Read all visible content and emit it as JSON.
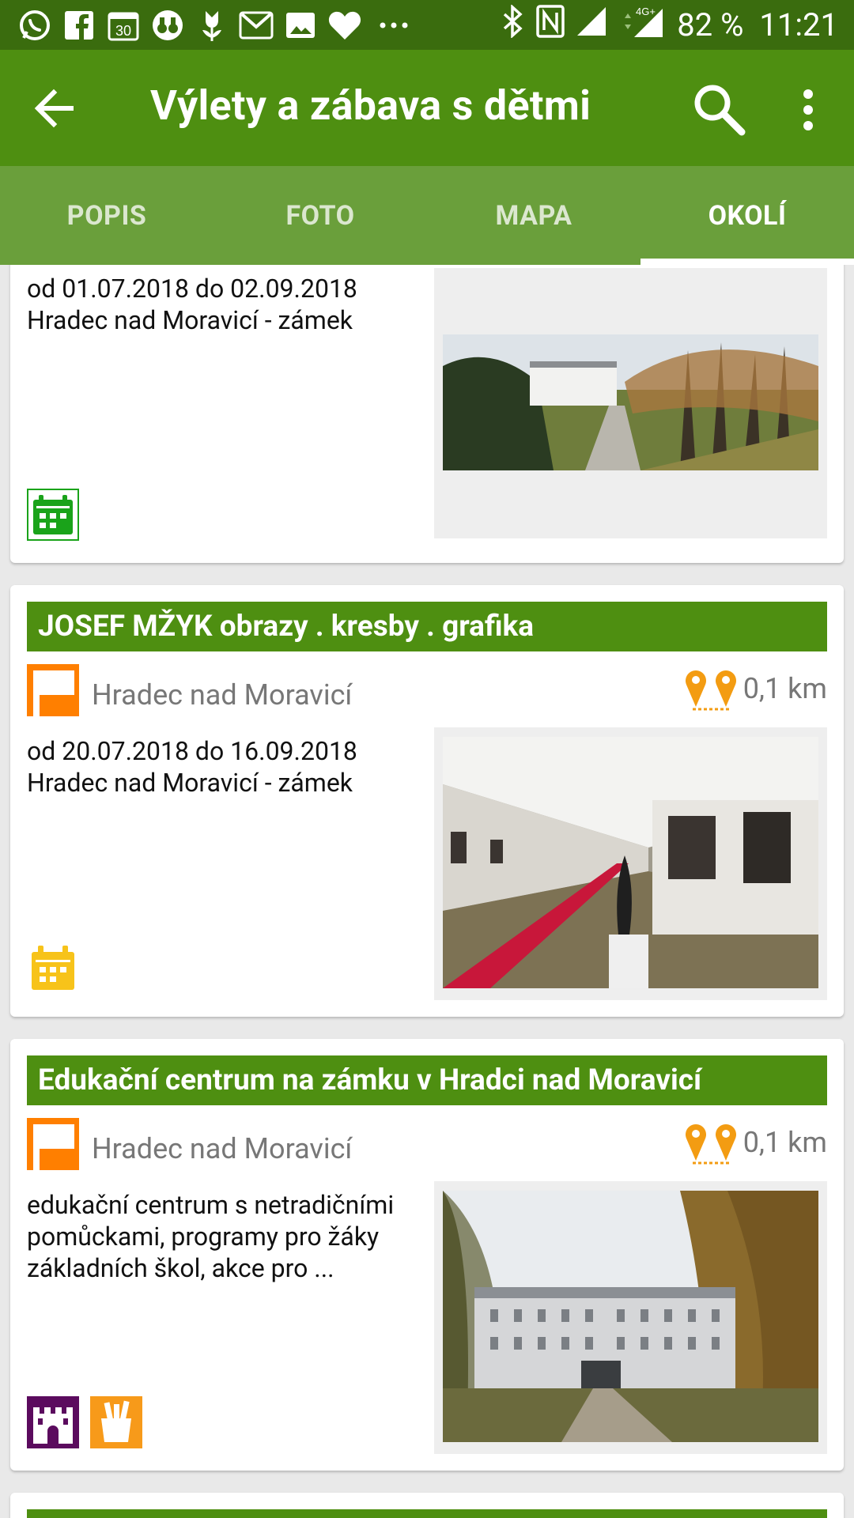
{
  "status_bar": {
    "battery": "82 %",
    "time": "11:21",
    "network": "4G+",
    "calendar_day": "30",
    "icons": [
      "whatsapp-icon",
      "facebook-icon",
      "calendar-icon",
      "binoculars-icon",
      "tulip-icon",
      "gmail-icon",
      "image-icon",
      "heart-icon",
      "more-dots-icon",
      "bluetooth-icon",
      "nfc-icon",
      "signal-icon",
      "signal-4g-icon"
    ]
  },
  "app_bar": {
    "title": "Výlety a zábava s dětmi",
    "back_icon": "arrow-left-icon",
    "search_icon": "search-icon",
    "menu_icon": "more-vert-icon"
  },
  "tabs": [
    {
      "label": "POPIS",
      "active": false
    },
    {
      "label": "FOTO",
      "active": false
    },
    {
      "label": "MAPA",
      "active": false
    },
    {
      "label": "OKOLÍ",
      "active": true
    }
  ],
  "cards": [
    {
      "desc_line1": "od 01.07.2018 do 02.09.2018",
      "desc_line2": "Hradec nad Moravicí - zámek",
      "category_icon": "calendar-green-icon",
      "photo": "chateau-park-autumn"
    },
    {
      "title": "JOSEF MŽYK  obrazy . kresby . grafika",
      "place": "Hradec nad Moravicí",
      "distance": "0,1 km",
      "desc_line1": "od 20.07.2018 do 16.09.2018",
      "desc_line2": "Hradec nad Moravicí - zámek",
      "category_icon": "calendar-yellow-icon",
      "photo": "gallery-red-carpet"
    },
    {
      "title": "Edukační centrum na zámku v Hradci nad Moravicí",
      "place": "Hradec nad Moravicí",
      "distance": "0,1 km",
      "desc_line1": "edukační centrum s netradičními",
      "desc_line2": "pomůckami, programy pro žáky",
      "desc_line3": "základních škol, akce pro ...",
      "category_icons": [
        "castle-icon",
        "school-supplies-icon"
      ],
      "photo": "chateau-front-alley"
    }
  ],
  "colors": {
    "status_bar": "#3a6c0e",
    "app_bar": "#4e8f11",
    "tab_bar": "#6a9f3b",
    "card_title": "#4e8f11",
    "place_icon": "#ff7f00",
    "distance_icon": "#f39c12",
    "calendar_green": "#1aa31a",
    "calendar_yellow": "#f7c31a",
    "castle_purple": "#5b0b5e",
    "school_orange": "#f79a1a"
  }
}
